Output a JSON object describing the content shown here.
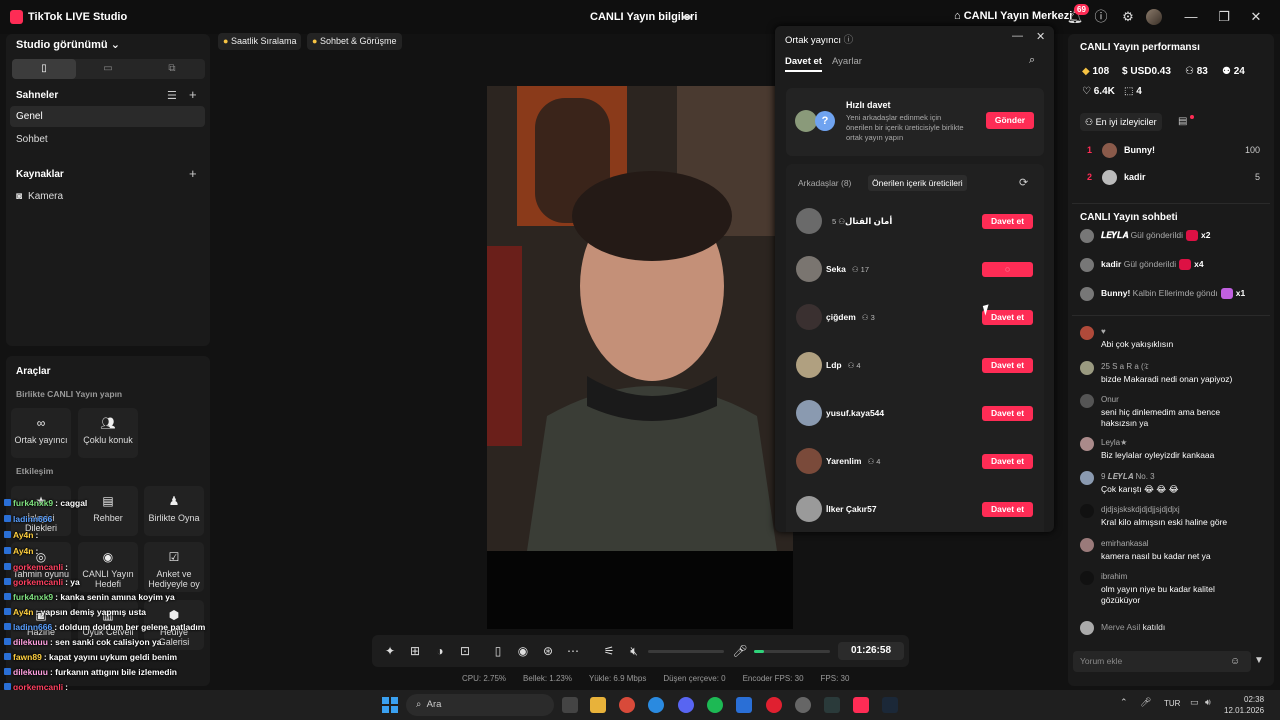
{
  "topbar": {
    "app_title": "TikTok LIVE Studio",
    "live_info": "CANLI Yayın bilgileri",
    "center": "CANLI Yayın Merkezi",
    "notif_count": "69"
  },
  "left": {
    "studio_view": "Studio görünümü",
    "scenes_title": "Sahneler",
    "scenes": [
      "Genel",
      "Sohbet"
    ],
    "sources_title": "Kaynaklar",
    "sources": [
      "Kamera"
    ],
    "tools_title": "Araçlar",
    "together_title": "Birlikte CANLI Yayın yapın",
    "tools_together": [
      "Ortak yayıncı",
      "Çoklu konuk"
    ],
    "interaction_title": "Etkileşim",
    "tools_interaction": [
      "İzleyici Dilekleri",
      "Rehber",
      "Birlikte Oyna",
      "Tahmin oyunu",
      "CANLI Yayın Hedefi",
      "Anket ve Hediyeyle oy",
      "Hazine",
      "Oyuk Cetveli",
      "Hediye Galerisi"
    ]
  },
  "overlay_chat": [
    {
      "user": "furk4nxk9",
      "msg": ": caggal",
      "color": "#7fe07f"
    },
    {
      "user": "ladinn666",
      "msg": "",
      "color": "#5aa0ff"
    },
    {
      "user": "Ay4n",
      "msg": ":",
      "color": "#ffd040"
    },
    {
      "user": "Ay4n",
      "msg": ":",
      "color": "#ffd040"
    },
    {
      "user": "gorkemcanli",
      "msg": ":",
      "color": "#ff4060"
    },
    {
      "user": "gorkemcanli",
      "msg": ": ya",
      "color": "#ff4060"
    },
    {
      "user": "furk4nxk9",
      "msg": ": kanka senin amına koyim ya",
      "color": "#7fe07f"
    },
    {
      "user": "Ay4n",
      "msg": ": yapsın demiş yapmış usta",
      "color": "#ffd040"
    },
    {
      "user": "ladinn666",
      "msg": ": doldum doldum ber gelene patladım",
      "color": "#5aa0ff"
    },
    {
      "user": "dilekuuu",
      "msg": ": sen sanki cok calisiyon ya",
      "color": "#ffa0e0"
    },
    {
      "user": "fawn89",
      "msg": ": kapat yayını uykum geldi benim",
      "color": "#ffd040"
    },
    {
      "user": "dilekuuu",
      "msg": ": furkanın attıgını bile izlemedin",
      "color": "#ffa0e0"
    },
    {
      "user": "gorkemcanli",
      "msg": ":",
      "color": "#ff4060"
    },
    {
      "user": "Ay4n",
      "msg": ": videoyu siklemedin",
      "color": "#ffd040"
    },
    {
      "user": "furk4nxk9",
      "msg": ": harbi amk attığım şeyi ilk defa izliyor",
      "color": "#7fe07f"
    }
  ],
  "center": {
    "tags": [
      "Saatlik Sıralama",
      "Sohbet & Görüşme"
    ],
    "timer": "01:26:58",
    "stats": [
      "CPU: 2.75%",
      "Bellek: 1.23%",
      "Yükle: 6.9 Mbps",
      "Düşen çerçeve: 0",
      "Encoder FPS: 30",
      "FPS: 30"
    ]
  },
  "popup": {
    "title": "Ortak yayıncı",
    "tab_invite": "Davet et",
    "tab_settings": "Ayarlar",
    "quick_title": "Hızlı davet",
    "quick_desc": "Yeni arkadaşlar edinmek için önerilen bir içerik üreticisiyle birlikte ortak yayın yapın",
    "send": "Gönder",
    "friends_tab": "Arkadaşlar (8)",
    "suggested_tab": "Önerilen içerik üreticileri",
    "invite_label": "Davet et",
    "creators": [
      {
        "name": "أمان القتال",
        "count": "5",
        "av": "#6a6a6a"
      },
      {
        "name": "Seka",
        "count": "17",
        "av": "#7a7570",
        "loading": true
      },
      {
        "name": "çiğdem",
        "count": "3",
        "av": "#3a3030"
      },
      {
        "name": "Ldp",
        "count": "4",
        "av": "#b0a080"
      },
      {
        "name": "yusuf.kaya544",
        "count": "",
        "av": "#8a9ab0"
      },
      {
        "name": "Yarenlim",
        "count": "4",
        "av": "#7a4a3a"
      },
      {
        "name": "İlker Çakır57",
        "count": "",
        "av": "#9a9a9a"
      }
    ]
  },
  "right": {
    "perf_title": "CANLI Yayın performansı",
    "stats": [
      "108",
      "USD0.43",
      "83",
      "24",
      "6.4K",
      "4"
    ],
    "top_viewers": "En iyi izleyiciler",
    "ranking": [
      {
        "rank": "1",
        "name": "Bunny!",
        "value": "100"
      },
      {
        "rank": "2",
        "name": "kadir",
        "value": "5"
      }
    ],
    "chat_title": "CANLI Yayın sohbeti",
    "gifts": [
      {
        "user": "𝑳𝑬𝒀𝑳𝑨",
        "text": "Gül gönderildi",
        "mult": "x2"
      },
      {
        "user": "kadir",
        "text": "Gül gönderildi",
        "mult": "x4"
      },
      {
        "user": "Bunny!",
        "text": "Kalbin Ellerimde göndı",
        "mult": "x1"
      }
    ],
    "chat": [
      {
        "user": "♥",
        "msg": "Abi çok yakışıklısın"
      },
      {
        "user": "25  S a R a (𝔗",
        "msg": "bizde Makaradi nedi onan yapiyoz)"
      },
      {
        "user": "Onur",
        "msg": "seni hiç dinlemedim ama bence haksızsın ya"
      },
      {
        "user": "Leyla★",
        "msg": "Biz leylalar oyleyizdir kankaaa"
      },
      {
        "user": "9  𝑳𝑬𝒀𝑳𝑨  No. 3",
        "msg": "Çok karıştı 😂 😂 😂"
      },
      {
        "user": "djdjsjskskdjdjdjjsjdjdjxj",
        "msg": "Kral kilo almışsın eski haline göre"
      },
      {
        "user": "emirhankasal",
        "msg": "kamera nasıl bu kadar net ya"
      },
      {
        "user": "ibrahim",
        "msg": "olm yayın niye bu kadar kalitel gözüküyor"
      }
    ],
    "joined_user": "Merve Asil",
    "joined_text": "katıldı",
    "comment_placeholder": "Yorum ekle"
  },
  "taskbar": {
    "search": "Ara",
    "lang": "TUR",
    "time": "02:38",
    "date": "12.01.2026"
  }
}
